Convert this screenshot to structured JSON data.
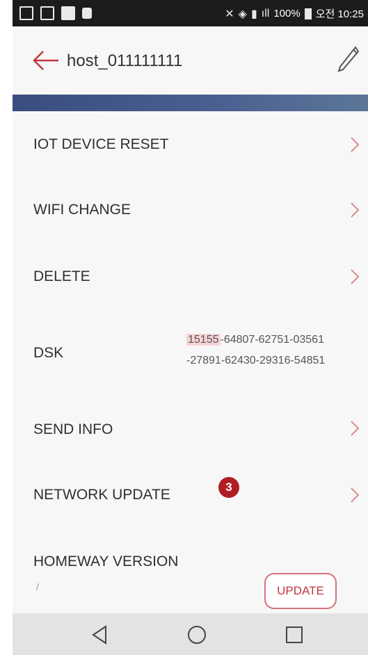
{
  "statusbar": {
    "battery": "100%",
    "time": "오전 10:25"
  },
  "appbar": {
    "title": "host_011111111"
  },
  "menu": [
    {
      "label": "IOT DEVICE RESET"
    },
    {
      "label": "WIFI CHANGE"
    },
    {
      "label": "DELETE"
    },
    {
      "label": "SEND INFO"
    },
    {
      "label": "NETWORK UPDATE"
    }
  ],
  "dsk": {
    "label": "DSK",
    "highlight": "15155",
    "line1_rest": "-64807-62751-03561",
    "line2": "-27891-62430-29316-54851"
  },
  "badge": "3",
  "homeway": {
    "label": "HOMEWAY VERSION",
    "value": "/",
    "update_label": "UPDATE"
  },
  "colors": {
    "accent": "#c2353f",
    "band": "#3a4d7e",
    "badge": "#b01e23"
  }
}
